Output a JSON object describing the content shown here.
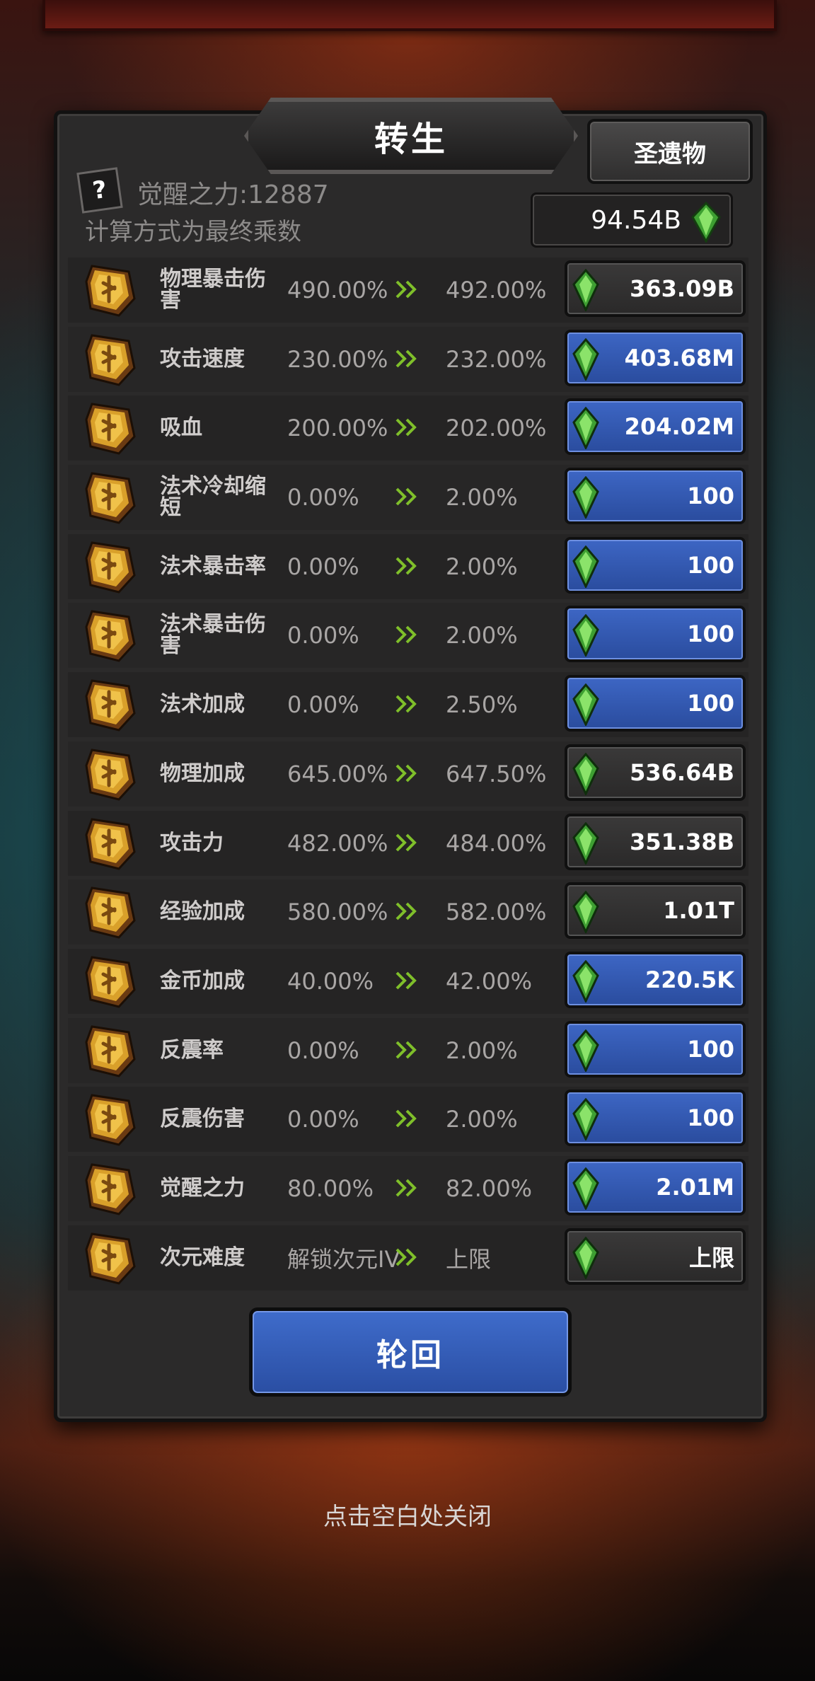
{
  "title": "转生",
  "relic_button": "圣遗物",
  "help_icon": "?",
  "awaken_power": "觉醒之力:12887",
  "formula_note": "计算方式为最终乘数",
  "currency_amount": "94.54B",
  "rows": [
    {
      "name": "物理暴击伤害",
      "current": "490.00%",
      "next": "492.00%",
      "cost": "363.09B",
      "style": "gray"
    },
    {
      "name": "攻击速度",
      "current": "230.00%",
      "next": "232.00%",
      "cost": "403.68M",
      "style": "blue"
    },
    {
      "name": "吸血",
      "current": "200.00%",
      "next": "202.00%",
      "cost": "204.02M",
      "style": "blue"
    },
    {
      "name": "法术冷却缩短",
      "current": "0.00%",
      "next": "2.00%",
      "cost": "100",
      "style": "blue"
    },
    {
      "name": "法术暴击率",
      "current": "0.00%",
      "next": "2.00%",
      "cost": "100",
      "style": "blue"
    },
    {
      "name": "法术暴击伤害",
      "current": "0.00%",
      "next": "2.00%",
      "cost": "100",
      "style": "blue"
    },
    {
      "name": "法术加成",
      "current": "0.00%",
      "next": "2.50%",
      "cost": "100",
      "style": "blue"
    },
    {
      "name": "物理加成",
      "current": "645.00%",
      "next": "647.50%",
      "cost": "536.64B",
      "style": "gray"
    },
    {
      "name": "攻击力",
      "current": "482.00%",
      "next": "484.00%",
      "cost": "351.38B",
      "style": "gray"
    },
    {
      "name": "经验加成",
      "current": "580.00%",
      "next": "582.00%",
      "cost": "1.01T",
      "style": "gray"
    },
    {
      "name": "金币加成",
      "current": "40.00%",
      "next": "42.00%",
      "cost": "220.5K",
      "style": "blue"
    },
    {
      "name": "反震率",
      "current": "0.00%",
      "next": "2.00%",
      "cost": "100",
      "style": "blue"
    },
    {
      "name": "反震伤害",
      "current": "0.00%",
      "next": "2.00%",
      "cost": "100",
      "style": "blue"
    },
    {
      "name": "觉醒之力",
      "current": "80.00%",
      "next": "82.00%",
      "cost": "2.01M",
      "style": "blue"
    },
    {
      "name": "次元难度",
      "current": "解锁次元IV",
      "next": "上限",
      "cost": "上限",
      "style": "gray"
    }
  ],
  "reincarnate_button": "轮回",
  "close_hint": "点击空白处关闭",
  "colors": {
    "blue_button": "#3a62bf",
    "gray_button": "#343333",
    "panel": "#2b2a2a",
    "gem": "#4fbf3f",
    "rune": "#d9a02a"
  }
}
